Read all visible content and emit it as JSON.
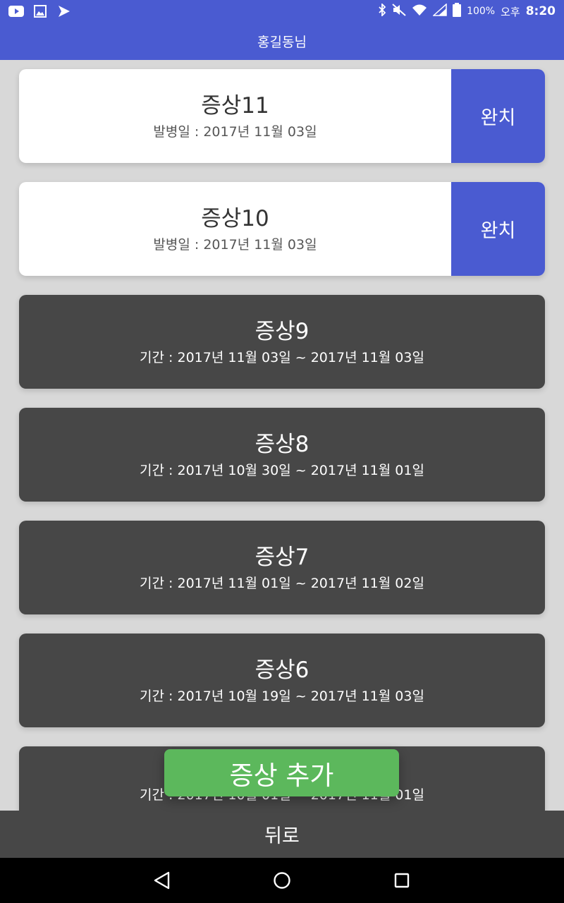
{
  "status_bar": {
    "battery_pct": "100%",
    "am_pm": "오후",
    "time": "8:20",
    "left_icons": [
      "youtube-icon",
      "gallery-icon",
      "app-check-icon"
    ],
    "right_icons": [
      "bluetooth-icon",
      "mute-icon",
      "wifi-icon",
      "signal-icon",
      "battery-icon"
    ]
  },
  "app_bar": {
    "title": "홍길동님"
  },
  "symptoms": [
    {
      "title": "증상11",
      "detail": "발병일 : 2017년 11월 03일",
      "state": "active",
      "action_label": "완치"
    },
    {
      "title": "증상10",
      "detail": "발병일 : 2017년 11월 03일",
      "state": "active",
      "action_label": "완치"
    },
    {
      "title": "증상9",
      "detail": "기간 : 2017년 11월 03일 ~ 2017년 11월 03일",
      "state": "done"
    },
    {
      "title": "증상8",
      "detail": "기간 : 2017년 10월 30일 ~ 2017년 11월 01일",
      "state": "done"
    },
    {
      "title": "증상7",
      "detail": "기간 : 2017년 11월 01일 ~ 2017년 11월 02일",
      "state": "done"
    },
    {
      "title": "증상6",
      "detail": "기간 : 2017년 10월 19일 ~ 2017년 11월 03일",
      "state": "done"
    },
    {
      "title": "",
      "detail": "기간 : 2017년 10월 01일 ~ 2017년 11월 01일",
      "state": "done"
    }
  ],
  "add_button": {
    "label": "증상 추가"
  },
  "back_button": {
    "label": "뒤로"
  },
  "colors": {
    "primary": "#4a5bd1",
    "card_done": "#474747",
    "add_green": "#5cb85c"
  }
}
